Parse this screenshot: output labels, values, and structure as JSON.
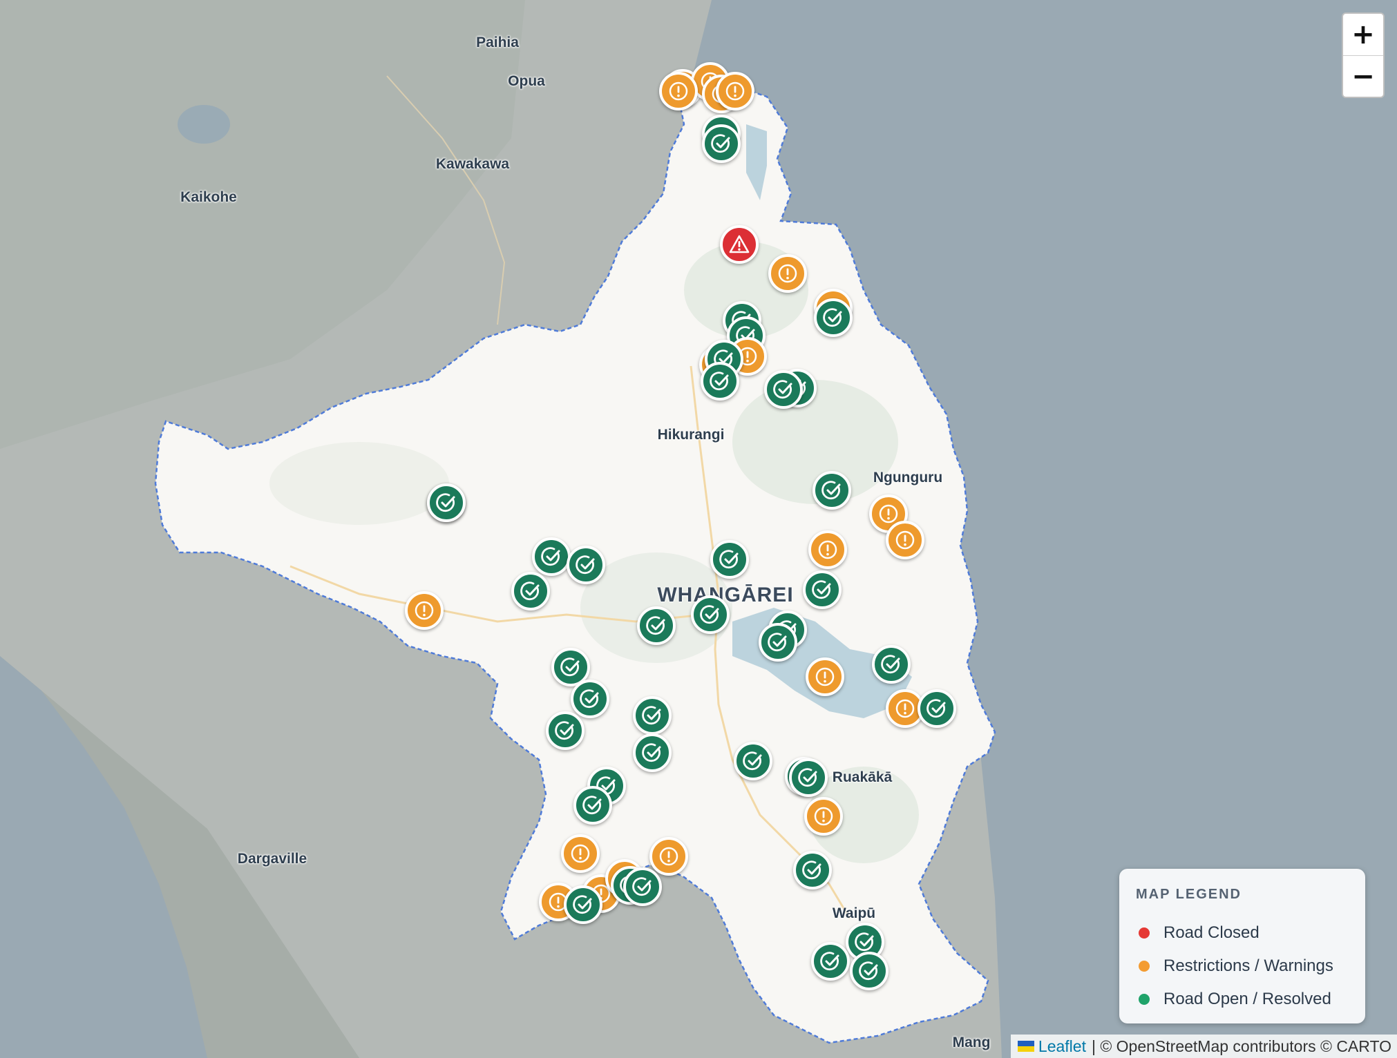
{
  "map": {
    "places": [
      {
        "name": "Paihia",
        "size": "normal"
      },
      {
        "name": "Opua",
        "size": "normal"
      },
      {
        "name": "Kawakawa",
        "size": "normal"
      },
      {
        "name": "Kaikohe",
        "size": "normal"
      },
      {
        "name": "Hikurangi",
        "size": "normal"
      },
      {
        "name": "Ngunguru",
        "size": "normal"
      },
      {
        "name": "WHANGĀREI",
        "size": "big"
      },
      {
        "name": "Ruakākā",
        "size": "normal"
      },
      {
        "name": "Dargaville",
        "size": "normal"
      },
      {
        "name": "Waipū",
        "size": "normal"
      },
      {
        "name": "Mang",
        "size": "normal"
      }
    ],
    "markers": [
      {
        "status": "warning"
      },
      {
        "status": "warning"
      },
      {
        "status": "warning"
      },
      {
        "status": "warning"
      },
      {
        "status": "warning"
      },
      {
        "status": "open"
      },
      {
        "status": "open"
      },
      {
        "status": "closed"
      },
      {
        "status": "warning"
      },
      {
        "status": "warning"
      },
      {
        "status": "open"
      },
      {
        "status": "open"
      },
      {
        "status": "open"
      },
      {
        "status": "warning"
      },
      {
        "status": "warning"
      },
      {
        "status": "open"
      },
      {
        "status": "open"
      },
      {
        "status": "open"
      },
      {
        "status": "open"
      },
      {
        "status": "open"
      },
      {
        "status": "open"
      },
      {
        "status": "open"
      },
      {
        "status": "warning"
      },
      {
        "status": "warning"
      },
      {
        "status": "warning"
      },
      {
        "status": "open"
      },
      {
        "status": "open"
      },
      {
        "status": "open"
      },
      {
        "status": "open"
      },
      {
        "status": "warning"
      },
      {
        "status": "open"
      },
      {
        "status": "open"
      },
      {
        "status": "open"
      },
      {
        "status": "open"
      },
      {
        "status": "open"
      },
      {
        "status": "open"
      },
      {
        "status": "warning"
      },
      {
        "status": "open"
      },
      {
        "status": "warning"
      },
      {
        "status": "open"
      },
      {
        "status": "open"
      },
      {
        "status": "open"
      },
      {
        "status": "open"
      },
      {
        "status": "open"
      },
      {
        "status": "open"
      },
      {
        "status": "open"
      },
      {
        "status": "open"
      },
      {
        "status": "open"
      },
      {
        "status": "open"
      },
      {
        "status": "warning"
      },
      {
        "status": "warning"
      },
      {
        "status": "warning"
      },
      {
        "status": "warning"
      },
      {
        "status": "warning"
      },
      {
        "status": "warning"
      },
      {
        "status": "open"
      },
      {
        "status": "open"
      },
      {
        "status": "open"
      },
      {
        "status": "open"
      },
      {
        "status": "open"
      },
      {
        "status": "open"
      },
      {
        "status": "open"
      }
    ]
  },
  "colors": {
    "closed": "#dc2f35",
    "warning": "#ee9a2d",
    "open": "#1b7a5a",
    "open_dot": "#1fa36a",
    "closed_dot": "#e53935",
    "warning_dot": "#f39c32"
  },
  "icons": {
    "closed": "warning-triangle-icon",
    "warning": "exclamation-icon",
    "open": "check-circle-icon"
  },
  "zoom": {
    "in_label": "+",
    "out_label": "−"
  },
  "legend": {
    "title": "MAP LEGEND",
    "items": [
      {
        "key": "closed",
        "label": "Road Closed"
      },
      {
        "key": "warning",
        "label": "Restrictions / Warnings"
      },
      {
        "key": "open",
        "label": "Road Open / Resolved"
      }
    ]
  },
  "attribution": {
    "leaflet": "Leaflet",
    "rest": "| © OpenStreetMap contributors © CARTO"
  }
}
